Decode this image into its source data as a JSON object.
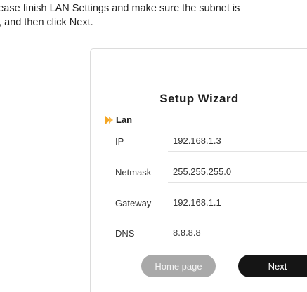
{
  "instruction": {
    "line1": "lease finish LAN Settings and make sure the subnet is",
    "line2": "t, and then click Next."
  },
  "wizard": {
    "title": "Setup Wizard",
    "section_label": "Lan",
    "section_icon": "double-chevron-right-icon",
    "accent_color": "#f5a623",
    "fields": [
      {
        "label": "IP",
        "value": "192.168.1.3"
      },
      {
        "label": "Netmask",
        "value": "255.255.255.0"
      },
      {
        "label": "Gateway",
        "value": "192.168.1.1"
      },
      {
        "label": "DNS",
        "value": "8.8.8.8"
      }
    ],
    "home_button": "Home page",
    "next_button": "Next"
  }
}
